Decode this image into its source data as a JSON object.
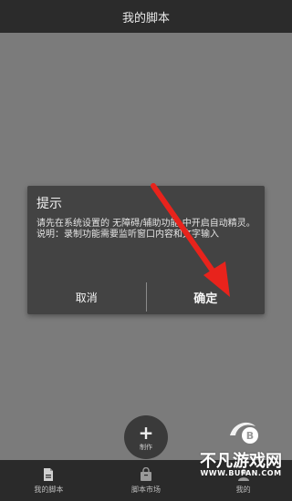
{
  "app_bar": {
    "title": "我的脚本"
  },
  "dialog": {
    "title": "提示",
    "message_line1": "请先在系统设置的 无障碍/辅助功能 中开启自动精灵。",
    "message_line2": "说明：录制功能需要监听窗口内容和文字输入",
    "cancel_label": "取消",
    "ok_label": "确定"
  },
  "fab": {
    "icon": "plus-icon",
    "label": "制作"
  },
  "bottom_nav": {
    "items": [
      {
        "icon": "document-icon",
        "label": "我的脚本"
      },
      {
        "icon": "shopping-bag-icon",
        "label": "脚本市场"
      },
      {
        "icon": "person-icon",
        "label": "我的"
      }
    ]
  },
  "watermark": {
    "text": "不凡游戏网",
    "url": "WWW.BUFAN.COM"
  },
  "colors": {
    "overlay": "#7b7b7b",
    "dialog_bg": "#434343",
    "bar_bg": "#2b2b2b",
    "arrow": "#e8231c"
  }
}
